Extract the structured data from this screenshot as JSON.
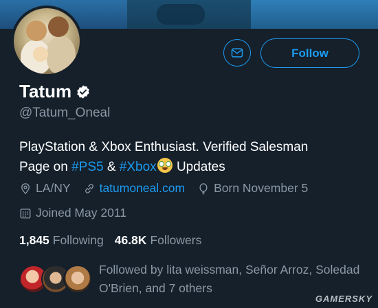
{
  "profile": {
    "name": "Tatum",
    "handle": "@Tatum_Oneal",
    "bio_line1": "PlayStation & Xbox Enthusiast. Verified Salesman",
    "bio_prefix": "Page on ",
    "hashtag1": "#PS5",
    "bio_amp": " & ",
    "hashtag2": "#Xbox",
    "bio_suffix": " Updates",
    "location": "LA/NY",
    "website": "tatumoneal.com",
    "birthday": "Born November 5",
    "joined": "Joined May 2011"
  },
  "counts": {
    "following_value": "1,845",
    "following_label": "Following",
    "followers_value": "46.8K",
    "followers_label": "Followers"
  },
  "followed_by": {
    "text": "Followed by lita weissman, Señor Arroz, Soledad O'Brien, and 7 others"
  },
  "actions": {
    "follow_label": "Follow"
  },
  "icons": {
    "message": "envelope-icon",
    "verified": "verified-badge-icon",
    "location": "location-pin-icon",
    "link": "link-icon",
    "birthday": "balloon-icon",
    "joined": "calendar-icon"
  },
  "colors": {
    "background": "#15202b",
    "accent": "#1d9bf0",
    "secondary_text": "#8b98a5"
  },
  "watermark": "GAMERSKY"
}
